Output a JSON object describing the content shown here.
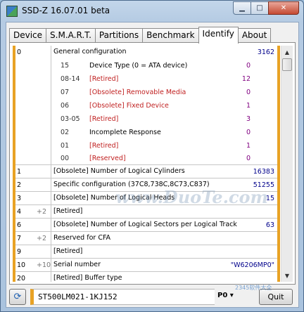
{
  "window": {
    "title": "SSD-Z 16.07.01 beta"
  },
  "tabs": [
    "Device",
    "S.M.A.R.T.",
    "Partitions",
    "Benchmark",
    "Identify",
    "About"
  ],
  "active_tab": "Identify",
  "general": {
    "index": "0",
    "label": "General configuration",
    "value": "3162",
    "bits": [
      {
        "bits": "15",
        "desc": "Device Type (0 = ATA device)",
        "val": "0"
      },
      {
        "bits": "08-14",
        "desc": "[Retired]",
        "val": "12"
      },
      {
        "bits": "07",
        "desc": "[Obsolete] Removable Media",
        "val": "0"
      },
      {
        "bits": "06",
        "desc": "[Obsolete] Fixed Device",
        "val": "1"
      },
      {
        "bits": "03-05",
        "desc": "[Retired]",
        "val": "3"
      },
      {
        "bits": "02",
        "desc": "Incomplete Response",
        "val": "0"
      },
      {
        "bits": "01",
        "desc": "[Retired]",
        "val": "1"
      },
      {
        "bits": "00",
        "desc": "[Reserved]",
        "val": "0"
      }
    ]
  },
  "rows": [
    {
      "idx": "1",
      "extra": "",
      "label": "[Obsolete] Number of Logical Cylinders",
      "value": "16383"
    },
    {
      "idx": "2",
      "extra": "",
      "label": "Specific configuration (37C8,738C,8C73,C837)",
      "value": "51255"
    },
    {
      "idx": "3",
      "extra": "",
      "label": "[Obsolete] Number of Logical Heads",
      "value": "15"
    },
    {
      "idx": "4",
      "extra": "+2",
      "label": "[Retired]",
      "value": ""
    },
    {
      "idx": "6",
      "extra": "",
      "label": "[Obsolete] Number of Logical Sectors per Logical Track",
      "value": "63"
    },
    {
      "idx": "7",
      "extra": "+2",
      "label": "Reserved for CFA",
      "value": ""
    },
    {
      "idx": "9",
      "extra": "",
      "label": "[Retired]",
      "value": ""
    },
    {
      "idx": "10",
      "extra": "+10",
      "label": "Serial number",
      "value": "\"W6206MP0\""
    },
    {
      "idx": "20",
      "extra": "",
      "label": "[Retired] Buffer type",
      "value": ""
    }
  ],
  "bottom": {
    "drive": "ST500LM021-1KJ152",
    "port": "P0",
    "quit_label": "Quit"
  },
  "watermark": {
    "text": "www.DuoTe.com",
    "corner": "2345软件大全"
  }
}
